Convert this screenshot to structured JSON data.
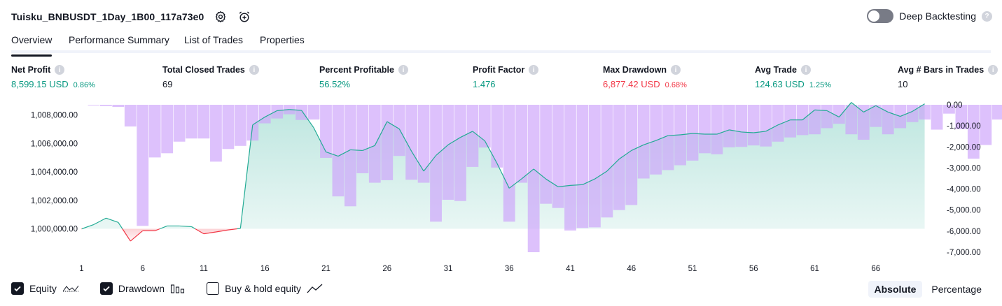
{
  "strategy": {
    "title": "Tuisku_BNBUSDT_1Day_1B00_117a73e0"
  },
  "deep_backtesting": {
    "label": "Deep Backtesting",
    "enabled": false,
    "help": "?"
  },
  "tabs": [
    {
      "label": "Overview",
      "active": true
    },
    {
      "label": "Performance Summary",
      "active": false
    },
    {
      "label": "List of Trades",
      "active": false
    },
    {
      "label": "Properties",
      "active": false
    }
  ],
  "metrics": [
    {
      "label": "Net Profit",
      "value": "8,599.15 USD",
      "pct": "0.86%",
      "tone": "pos"
    },
    {
      "label": "Total Closed Trades",
      "value": "69",
      "pct": "",
      "tone": "neu"
    },
    {
      "label": "Percent Profitable",
      "value": "56.52%",
      "pct": "",
      "tone": "pos"
    },
    {
      "label": "Profit Factor",
      "value": "1.476",
      "pct": "",
      "tone": "pos"
    },
    {
      "label": "Max Drawdown",
      "value": "6,877.42 USD",
      "pct": "0.68%",
      "tone": "neg"
    },
    {
      "label": "Avg Trade",
      "value": "124.63 USD",
      "pct": "1.25%",
      "tone": "pos"
    },
    {
      "label": "Avg # Bars in Trades",
      "value": "10",
      "pct": "",
      "tone": "neu"
    }
  ],
  "info_glyph": "i",
  "colors": {
    "equity_line": "#22ab94",
    "equity_fill": "#22ab94",
    "loss_line": "#f23645",
    "loss_fill": "#f23645",
    "drawdown_bar": "#cda4fa"
  },
  "chart_data": {
    "type": "line",
    "x_ticks": [
      "1",
      "6",
      "11",
      "16",
      "21",
      "26",
      "31",
      "36",
      "41",
      "46",
      "51",
      "56",
      "61",
      "66"
    ],
    "left_axis": {
      "ticks": [
        "1,008,000.00",
        "1,006,000.00",
        "1,004,000.00",
        "1,002,000.00",
        "1,000,000.00"
      ],
      "tick_values": [
        1008000,
        1006000,
        1004000,
        1002000,
        1000000
      ],
      "baseline": 1000000
    },
    "right_axis": {
      "ticks": [
        "0.00",
        "-1,000.00",
        "-2,000.00",
        "-3,000.00",
        "-4,000.00",
        "-5,000.00",
        "-6,000.00",
        "-7,000.00"
      ],
      "tick_values": [
        0,
        -1000,
        -2000,
        -3000,
        -4000,
        -5000,
        -6000,
        -7000
      ]
    },
    "series": [
      {
        "name": "Equity",
        "values": [
          999990,
          1000300,
          1000750,
          1000450,
          999140,
          999860,
          999860,
          1000200,
          1000200,
          1000150,
          999650,
          999780,
          999920,
          1000030,
          1007300,
          1007850,
          1008300,
          1008380,
          1008320,
          1007100,
          1005400,
          1005100,
          1005550,
          1005500,
          1005850,
          1007530,
          1007020,
          1005450,
          1004050,
          1005150,
          1005900,
          1006420,
          1006850,
          1006180,
          1004600,
          1002850,
          1003500,
          1004200,
          1003500,
          1002950,
          1003050,
          1003100,
          1003500,
          1004050,
          1004900,
          1005500,
          1005900,
          1006200,
          1006550,
          1006600,
          1006700,
          1006650,
          1006650,
          1006950,
          1006800,
          1006750,
          1006850,
          1007300,
          1007650,
          1007650,
          1008350,
          1008300,
          1007850,
          1008880,
          1008200,
          1008650,
          1008200,
          1007900,
          1008250,
          1008780
        ]
      },
      {
        "name": "Drawdown",
        "values": [
          0,
          -30,
          -60,
          -100,
          -1030,
          -5750,
          -2500,
          -2300,
          -1750,
          -1600,
          -1600,
          -2700,
          -2100,
          -1950,
          -1700,
          -880,
          -650,
          -450,
          -720,
          -700,
          -2520,
          -4350,
          -4820,
          -3250,
          -3700,
          -3580,
          -2430,
          -3560,
          -3700,
          -5550,
          -4510,
          -4570,
          -2950,
          -2030,
          -2980,
          -5550,
          -3700,
          -7000,
          -4700,
          -4900,
          -5970,
          -5850,
          -5820,
          -5350,
          -5000,
          -4760,
          -3500,
          -3310,
          -3100,
          -2870,
          -2650,
          -2300,
          -2350,
          -2020,
          -2000,
          -1930,
          -1980,
          -1750,
          -1550,
          -1440,
          -1400,
          -1110,
          -900,
          -1400,
          -1660,
          -1050,
          -1400,
          -1110,
          -820,
          -700,
          -1180,
          -420,
          -1160,
          -2560,
          -1910,
          -700
        ]
      }
    ]
  },
  "legend": {
    "items": [
      {
        "label": "Equity",
        "checked": true,
        "icon": "equity-wave-icon"
      },
      {
        "label": "Drawdown",
        "checked": true,
        "icon": "drawdown-bars-icon"
      },
      {
        "label": "Buy & hold equity",
        "checked": false,
        "icon": "buy-hold-line-icon"
      }
    ]
  },
  "mode": {
    "absolute": "Absolute",
    "percentage": "Percentage",
    "active": "absolute"
  }
}
